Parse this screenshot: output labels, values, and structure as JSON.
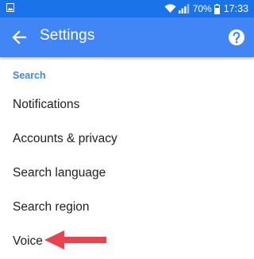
{
  "status_bar": {
    "battery_percent": "70%",
    "time": "17:33",
    "icons": [
      "gallery-icon",
      "wifi-icon",
      "signal-icon",
      "battery-icon"
    ]
  },
  "app_bar": {
    "title": "Settings",
    "back_icon": "arrow-back-icon",
    "help_icon": "help-icon",
    "color": "#4285f4"
  },
  "section": {
    "title": "Search"
  },
  "settings_items": [
    {
      "label": "Notifications"
    },
    {
      "label": "Accounts & privacy"
    },
    {
      "label": "Search language"
    },
    {
      "label": "Search region"
    },
    {
      "label": "Voice"
    }
  ],
  "annotation": {
    "icon": "red-arrow-pointer-icon",
    "color": "#e8434f"
  }
}
